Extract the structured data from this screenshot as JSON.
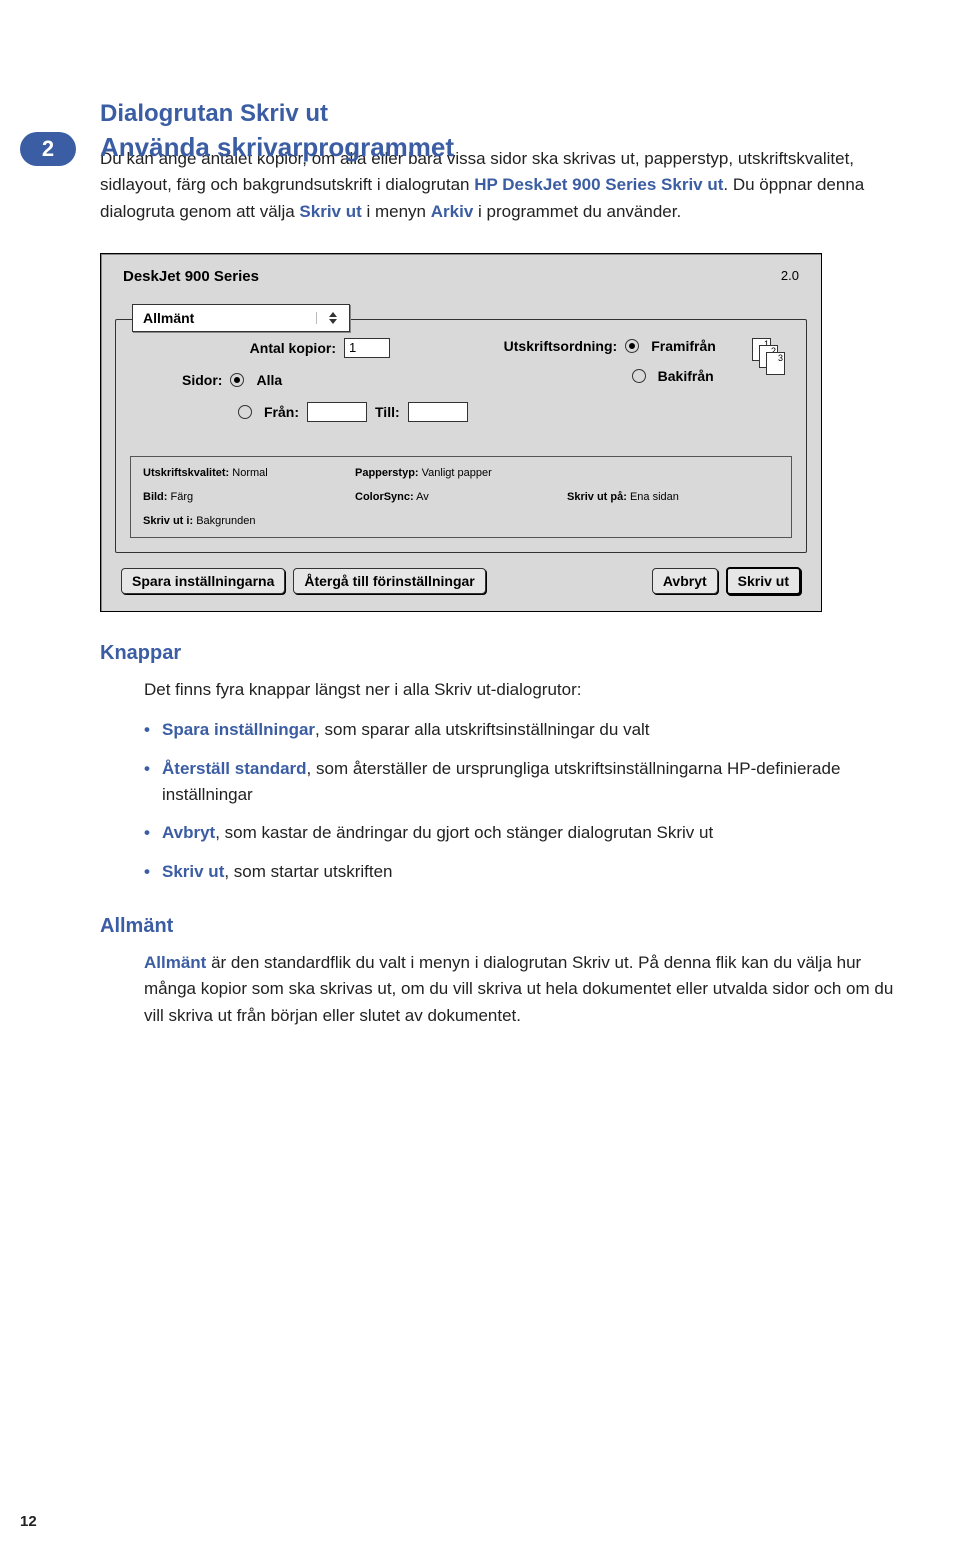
{
  "chapter": {
    "number": "2",
    "title": "Använda skrivarprogrammet"
  },
  "section_title": "Dialogrutan Skriv ut",
  "intro": {
    "pre": "Du kan ange antalet kopior, om alla eller bara vissa sidor ska skrivas ut, papperstyp, utskriftskvalitet, sidlayout, färg och bakgrundsutskrift i dialogrutan ",
    "product": "HP DeskJet 900 Series Skriv ut",
    "mid": ". Du öppnar denna dialogruta genom att välja ",
    "cmd": "Skriv ut",
    "mid2": " i menyn ",
    "menu": "Arkiv",
    "tail": " i programmet du använder."
  },
  "dialog": {
    "title": "DeskJet 900 Series",
    "version": "2.0",
    "tab": "Allmänt",
    "copies_label": "Antal kopior:",
    "copies_value": "1",
    "order_label": "Utskriftsordning:",
    "order_front": "Framifrån",
    "order_back": "Bakifrån",
    "pages_label": "Sidor:",
    "pages_all": "Alla",
    "pages_from": "Från:",
    "pages_to": "Till:",
    "info": {
      "quality_l": "Utskriftskvalitet:",
      "quality_v": "Normal",
      "image_l": "Bild:",
      "image_v": "Färg",
      "printin_l": "Skriv ut i:",
      "printin_v": "Bakgrunden",
      "paper_l": "Papperstyp:",
      "paper_v": "Vanligt papper",
      "cs_l": "ColorSync:",
      "cs_v": "Av",
      "side_l": "Skriv ut på:",
      "side_v": "Ena sidan"
    },
    "buttons": {
      "save": "Spara inställningarna",
      "restore": "Återgå till förinställningar",
      "cancel": "Avbryt",
      "print": "Skriv ut"
    }
  },
  "knappar": {
    "title": "Knappar",
    "lead": "Det finns fyra knappar längst ner i alla Skriv ut-dialogrutor:",
    "items": [
      {
        "bold": "Spara inställningar",
        "rest": ", som sparar alla utskriftsinställningar du valt"
      },
      {
        "bold": "Återställ standard",
        "rest": ", som återställer de ursprungliga utskriftsinställningarna HP-definierade inställningar"
      },
      {
        "bold": "Avbryt",
        "rest": ", som kastar de ändringar du gjort och stänger dialogrutan Skriv ut"
      },
      {
        "bold": "Skriv ut",
        "rest": ", som startar utskriften"
      }
    ]
  },
  "allmant": {
    "title": "Allmänt",
    "bold": "Allmänt",
    "text": " är den standardflik du valt i menyn i dialogrutan Skriv ut. På denna flik kan du välja hur många kopior som ska skrivas ut, om du vill skriva ut hela dokumentet eller utvalda sidor och om du vill skriva ut från början eller slutet av dokumentet."
  },
  "page_number": "12"
}
